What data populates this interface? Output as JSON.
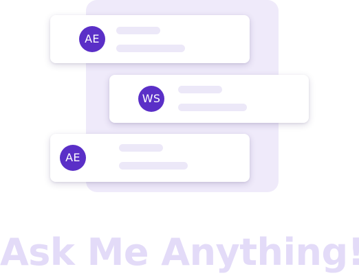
{
  "colors": {
    "accent": "#5a2fc7",
    "backdrop": "#efeafa",
    "placeholder_line": "#ece8f8",
    "heading": "#e3dbf8"
  },
  "cards": [
    {
      "avatar_initials": "AE"
    },
    {
      "avatar_initials": "WS"
    },
    {
      "avatar_initials": "AE"
    }
  ],
  "heading": "Ask Me Anything!"
}
